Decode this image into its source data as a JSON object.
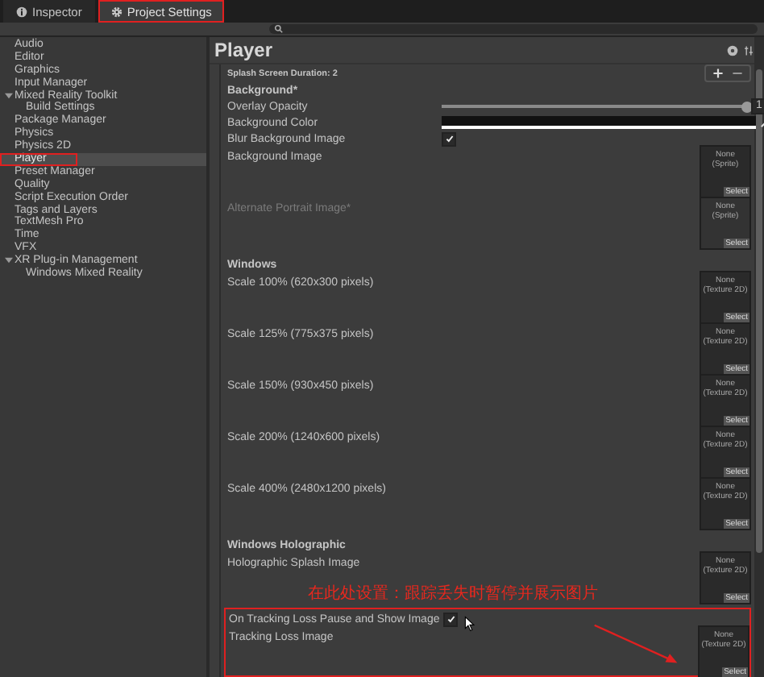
{
  "tabs": [
    {
      "label": "Inspector",
      "selected": false
    },
    {
      "label": "Project Settings",
      "selected": true
    }
  ],
  "sidebar": {
    "items": [
      {
        "label": "Audio",
        "selected": false
      },
      {
        "label": "Editor",
        "selected": false
      },
      {
        "label": "Graphics",
        "selected": false
      },
      {
        "label": "Input Manager",
        "selected": false
      },
      {
        "label": "Mixed Reality Toolkit",
        "selected": false,
        "expanded": true,
        "children": [
          {
            "label": "Build Settings",
            "selected": false
          }
        ]
      },
      {
        "label": "Package Manager",
        "selected": false
      },
      {
        "label": "Physics",
        "selected": false
      },
      {
        "label": "Physics 2D",
        "selected": false
      },
      {
        "label": "Player",
        "selected": true
      },
      {
        "label": "Preset Manager",
        "selected": false
      },
      {
        "label": "Quality",
        "selected": false
      },
      {
        "label": "Script Execution Order",
        "selected": false
      },
      {
        "label": "Tags and Layers",
        "selected": false
      },
      {
        "label": "TextMesh Pro",
        "selected": false
      },
      {
        "label": "Time",
        "selected": false
      },
      {
        "label": "VFX",
        "selected": false
      },
      {
        "label": "XR Plug-in Management",
        "selected": false,
        "expanded": true,
        "children": [
          {
            "label": "Windows Mixed Reality",
            "selected": false
          }
        ]
      }
    ]
  },
  "panel": {
    "title": "Player",
    "splash_label": "Splash Screen Duration: 2",
    "rows": [
      {
        "kind": "header",
        "label": "Background*"
      },
      {
        "kind": "slider",
        "label": "Overlay Opacity",
        "level": 1,
        "value": "1"
      },
      {
        "kind": "color",
        "label": "Background Color"
      },
      {
        "kind": "checkbox",
        "label": "Blur Background Image",
        "checked": true
      },
      {
        "kind": "image",
        "label": "Background Image",
        "slot": "None",
        "slot_type": "(Sprite)",
        "button": "Select",
        "disabled": false
      },
      {
        "kind": "image",
        "label": "Alternate Portrait Image*",
        "slot": "None",
        "slot_type": "(Sprite)",
        "button": "Select",
        "disabled": true
      },
      {
        "kind": "header",
        "label": "Windows"
      },
      {
        "kind": "image",
        "label": "Scale 100% (620x300 pixels)",
        "slot": "None",
        "slot_type": "(Texture 2D)",
        "button": "Select",
        "disabled": false
      },
      {
        "kind": "image",
        "label": "Scale 125% (775x375 pixels)",
        "slot": "None",
        "slot_type": "(Texture 2D)",
        "button": "Select",
        "disabled": false
      },
      {
        "kind": "image",
        "label": "Scale 150% (930x450 pixels)",
        "slot": "None",
        "slot_type": "(Texture 2D)",
        "button": "Select",
        "disabled": false
      },
      {
        "kind": "image",
        "label": "Scale 200% (1240x600 pixels)",
        "slot": "None",
        "slot_type": "(Texture 2D)",
        "button": "Select",
        "disabled": false
      },
      {
        "kind": "image",
        "label": "Scale 400% (2480x1200 pixels)",
        "slot": "None",
        "slot_type": "(Texture 2D)",
        "button": "Select",
        "disabled": false
      },
      {
        "kind": "header",
        "label": "Windows Holographic"
      },
      {
        "kind": "image",
        "label": "Holographic Splash Image",
        "slot": "None",
        "slot_type": "(Texture 2D)",
        "button": "Select",
        "disabled": false
      }
    ],
    "annotation": {
      "text": "在此处设置：跟踪丢失时暂停并展示图片",
      "rows": [
        {
          "kind": "checkbox",
          "label": "On Tracking Loss Pause and Show Image",
          "checked": true
        },
        {
          "kind": "image",
          "label": "Tracking Loss Image",
          "slot": "None",
          "slot_type": "(Texture 2D)",
          "button": "Select",
          "disabled": false
        }
      ]
    }
  }
}
